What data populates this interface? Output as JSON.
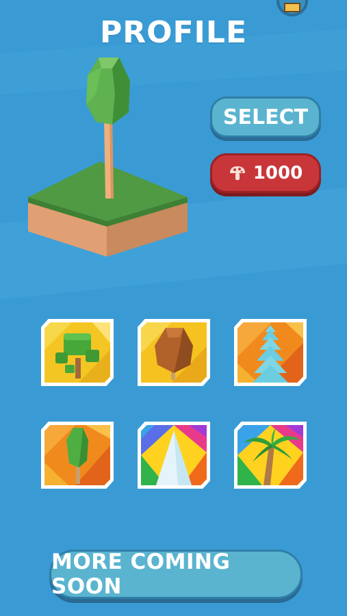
{
  "header": {
    "title": "PROFILE",
    "top_button_icon": "shop-icon"
  },
  "preview": {
    "item": "low-poly-tree-on-grass-block"
  },
  "actions": {
    "select_label": "SELECT",
    "price_value": "1000",
    "price_icon": "mushroom-icon"
  },
  "skins": [
    {
      "name": "bushy-tree",
      "background": "yellow"
    },
    {
      "name": "brown-round-tree",
      "background": "yellow"
    },
    {
      "name": "blue-pine-tree",
      "background": "orange"
    },
    {
      "name": "green-poplar-tree",
      "background": "orange"
    },
    {
      "name": "white-cone-tree",
      "background": "rainbow"
    },
    {
      "name": "palm-tree",
      "background": "rainbow"
    }
  ],
  "footer": {
    "more_label": "MORE COMING SOON"
  },
  "colors": {
    "background": "#3a9bd4",
    "button_blue": "#5ab4d0",
    "button_red": "#c9363a",
    "grass": "#4f9a42",
    "dirt": "#e7a877"
  }
}
